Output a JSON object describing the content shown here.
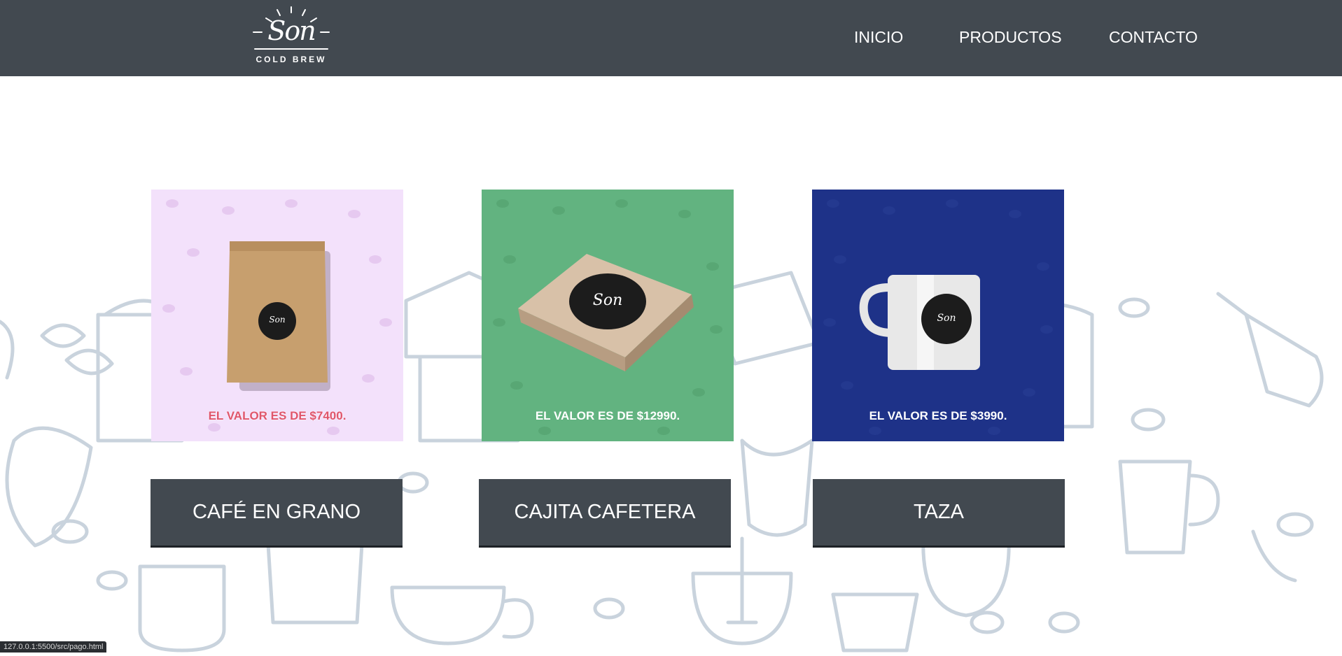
{
  "header": {
    "logo": {
      "script": "Son",
      "sub": "COLD BREW"
    },
    "nav": [
      {
        "label": "INICIO"
      },
      {
        "label": "PRODUCTOS"
      },
      {
        "label": "CONTACTO"
      }
    ]
  },
  "products": [
    {
      "name": "CAFÉ EN GRANO",
      "price_text": "EL VALOR ES DE $7400.",
      "bg_color": "#f3e1fb",
      "image": "coffee-bag"
    },
    {
      "name": "CAJITA CAFETERA",
      "price_text": "EL VALOR ES DE $12990.",
      "bg_color": "#62b380",
      "image": "coffee-box"
    },
    {
      "name": "TAZA",
      "price_text": "EL VALOR ES DE $3990.",
      "bg_color": "#1e3288",
      "image": "mug"
    }
  ],
  "status_bar": {
    "url": "127.0.0.1:5500/src/pago.html"
  },
  "colors": {
    "header": "#424950",
    "doodle_stroke": "#c9d3dd",
    "button": "#424950"
  }
}
